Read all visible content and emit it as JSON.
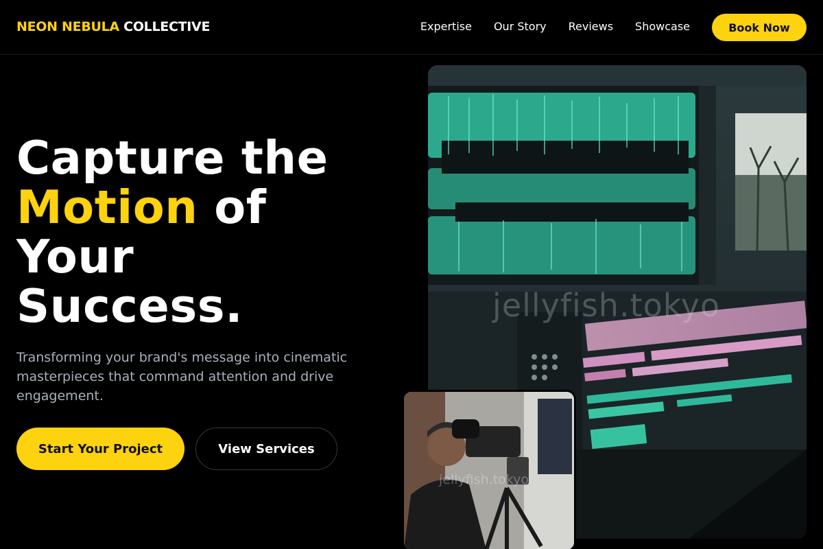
{
  "brand": {
    "name_accent": "NEON NEBULA",
    "name_rest": " COLLECTIVE"
  },
  "nav": {
    "items": [
      "Expertise",
      "Our Story",
      "Reviews",
      "Showcase"
    ],
    "cta": "Book Now"
  },
  "hero": {
    "line1": "Capture the",
    "line2_accent": "Motion",
    "line2_rest": " of",
    "line3": "Your",
    "line4": "Success.",
    "subtitle": "Transforming your brand's message into cinematic masterpieces that command attention and drive engagement.",
    "primary_cta": "Start Your Project",
    "secondary_cta": "View Services"
  },
  "images": {
    "editor_watermark": "jellyfish.tokyo",
    "camera_watermark": "jellyfish.tokyo"
  },
  "colors": {
    "accent": "#fdd20f",
    "background": "#000000",
    "subtitle": "#aab0bd"
  }
}
